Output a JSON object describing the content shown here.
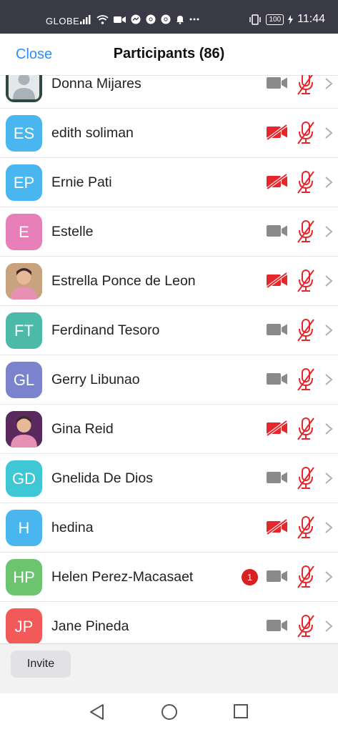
{
  "status_bar": {
    "carrier": "GLOBE",
    "battery": "100",
    "time": "11:44",
    "icons": [
      "signal-icon",
      "wifi-icon",
      "video-icon",
      "messenger-icon",
      "chrome-icon",
      "chrome-icon",
      "notification-icon",
      "more-icon",
      "vibrate-icon",
      "battery-icon",
      "charging-icon"
    ]
  },
  "header": {
    "close_label": "Close",
    "title": "Participants (86)"
  },
  "colors": {
    "accent": "#2d8cff",
    "muted_red": "#e5262b",
    "camera_gray": "#8a8a8a",
    "status_bar_bg": "#3a3a46"
  },
  "participants": [
    {
      "name": "Donna Mijares",
      "initials": "",
      "avatar_color": "#2e4a40",
      "avatar_type": "default-photo",
      "video_off": false,
      "muted": true,
      "badge": ""
    },
    {
      "name": "edith soliman",
      "initials": "ES",
      "avatar_color": "#49b6ef",
      "avatar_type": "initials",
      "video_off": true,
      "muted": true,
      "badge": ""
    },
    {
      "name": "Ernie Pati",
      "initials": "EP",
      "avatar_color": "#49b6ef",
      "avatar_type": "initials",
      "video_off": true,
      "muted": true,
      "badge": ""
    },
    {
      "name": "Estelle",
      "initials": "E",
      "avatar_color": "#e780b8",
      "avatar_type": "initials",
      "video_off": false,
      "muted": true,
      "badge": ""
    },
    {
      "name": "Estrella Ponce de Leon",
      "initials": "",
      "avatar_color": "#c9a27e",
      "avatar_type": "photo",
      "video_off": true,
      "muted": true,
      "badge": ""
    },
    {
      "name": "Ferdinand Tesoro",
      "initials": "FT",
      "avatar_color": "#4cb9a9",
      "avatar_type": "initials",
      "video_off": false,
      "muted": true,
      "badge": ""
    },
    {
      "name": "Gerry Libunao",
      "initials": "GL",
      "avatar_color": "#7b83cc",
      "avatar_type": "initials",
      "video_off": false,
      "muted": true,
      "badge": ""
    },
    {
      "name": "Gina Reid",
      "initials": "",
      "avatar_color": "#5a2a5e",
      "avatar_type": "photo",
      "video_off": true,
      "muted": true,
      "badge": ""
    },
    {
      "name": "Gnelida De Dios",
      "initials": "GD",
      "avatar_color": "#3fc7d6",
      "avatar_type": "initials",
      "video_off": false,
      "muted": true,
      "badge": ""
    },
    {
      "name": "hedina",
      "initials": "H",
      "avatar_color": "#49b6ef",
      "avatar_type": "initials",
      "video_off": true,
      "muted": true,
      "badge": ""
    },
    {
      "name": "Helen Perez-Macasaet",
      "initials": "HP",
      "avatar_color": "#6cc46f",
      "avatar_type": "initials",
      "video_off": false,
      "muted": true,
      "badge": "1"
    },
    {
      "name": "Jane Pineda",
      "initials": "JP",
      "avatar_color": "#f25a5a",
      "avatar_type": "initials",
      "video_off": false,
      "muted": true,
      "badge": ""
    }
  ],
  "bottom_bar": {
    "invite_label": "Invite"
  },
  "nav": {
    "icons": [
      "back-icon",
      "home-icon",
      "recents-icon"
    ]
  }
}
